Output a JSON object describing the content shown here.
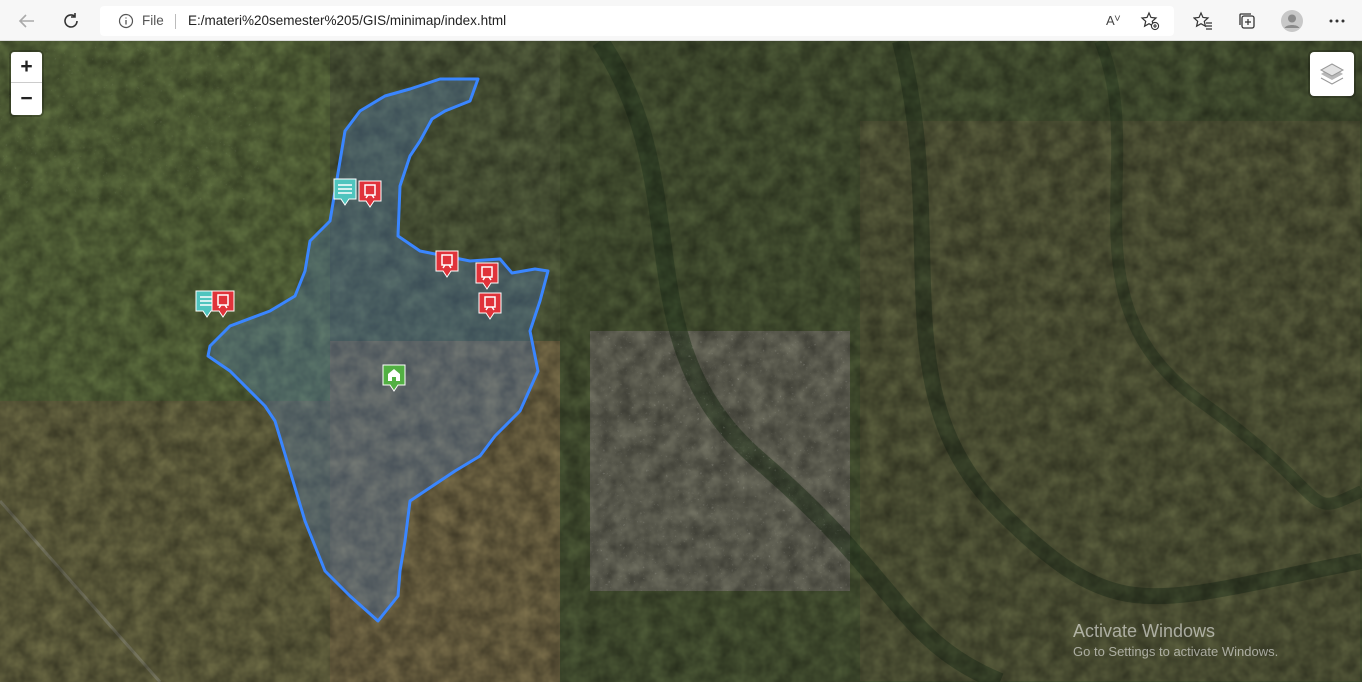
{
  "browser": {
    "file_label": "File",
    "url": "E:/materi%20semester%205/GIS/minimap/index.html",
    "read_aloud_label": "Aⱽ"
  },
  "map": {
    "zoom_in_label": "+",
    "zoom_out_label": "−",
    "markers": [
      {
        "type": "education",
        "color": "#4fc4be"
      },
      {
        "type": "bus-stop",
        "color": "#e0333a"
      },
      {
        "type": "education",
        "color": "#4fc4be"
      },
      {
        "type": "bus-stop",
        "color": "#e0333a"
      },
      {
        "type": "bus-stop",
        "color": "#e0333a"
      },
      {
        "type": "bus-stop",
        "color": "#e0333a"
      },
      {
        "type": "bus-stop",
        "color": "#e0333a"
      },
      {
        "type": "home",
        "color": "#52b043"
      }
    ],
    "boundary_color": "#3a86ff"
  },
  "watermark": {
    "title": "Activate Windows",
    "subtitle": "Go to Settings to activate Windows."
  }
}
